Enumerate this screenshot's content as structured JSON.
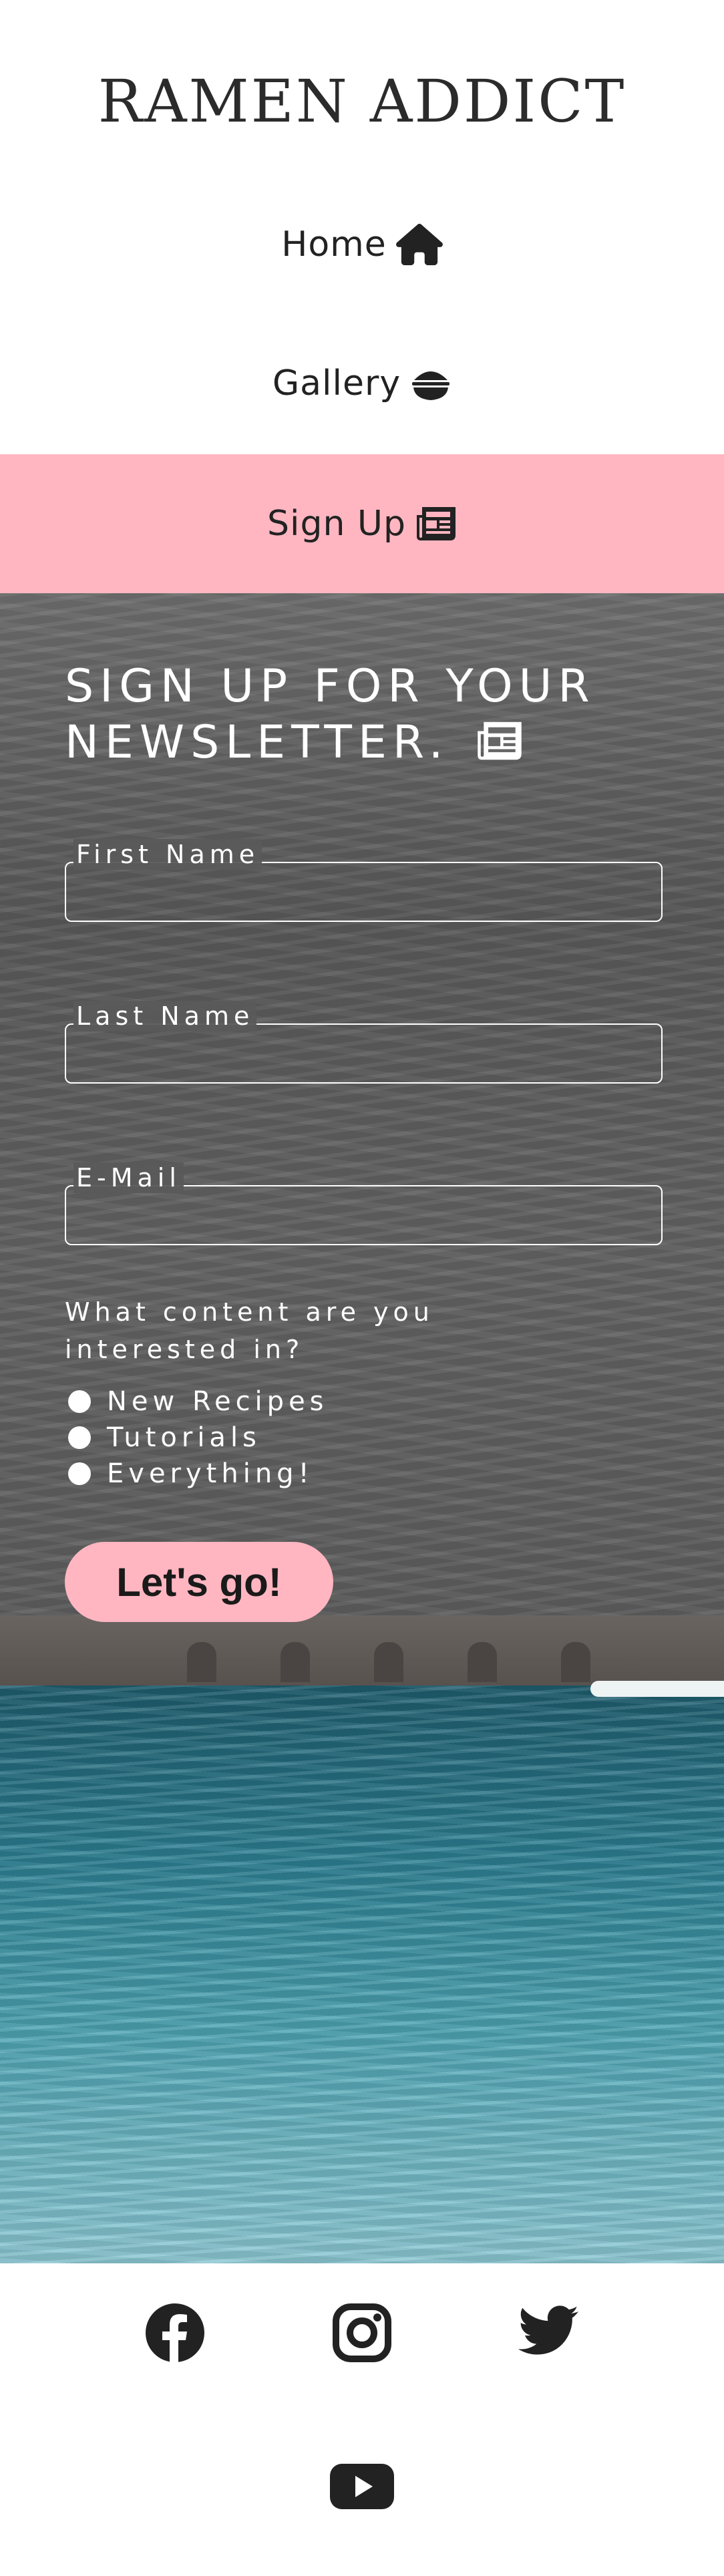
{
  "header": {
    "logo_text": "RAMEN ADDICT"
  },
  "nav": {
    "items": [
      {
        "label": "Home",
        "icon": "home-icon"
      },
      {
        "label": "Gallery",
        "icon": "ramen-bowl-icon"
      },
      {
        "label": "Sign Up",
        "icon": "newspaper-icon",
        "active": true
      }
    ],
    "active_color": "#ffb6c1"
  },
  "form": {
    "title": "SIGN UP FOR YOUR NEWSLETTER.",
    "title_icon": "newspaper-icon",
    "fields": [
      {
        "label": "First Name",
        "value": ""
      },
      {
        "label": "Last Name",
        "value": ""
      },
      {
        "label": "E-Mail",
        "value": ""
      }
    ],
    "question": "What content are you interested in?",
    "options": [
      {
        "label": "New Recipes"
      },
      {
        "label": "Tutorials"
      },
      {
        "label": "Everything!"
      }
    ],
    "submit_label": "Let's go!",
    "submit_color": "#ffb6c1"
  },
  "footer": {
    "social": [
      {
        "name": "facebook-icon"
      },
      {
        "name": "instagram-icon"
      },
      {
        "name": "twitter-icon"
      },
      {
        "name": "youtube-icon"
      }
    ]
  }
}
